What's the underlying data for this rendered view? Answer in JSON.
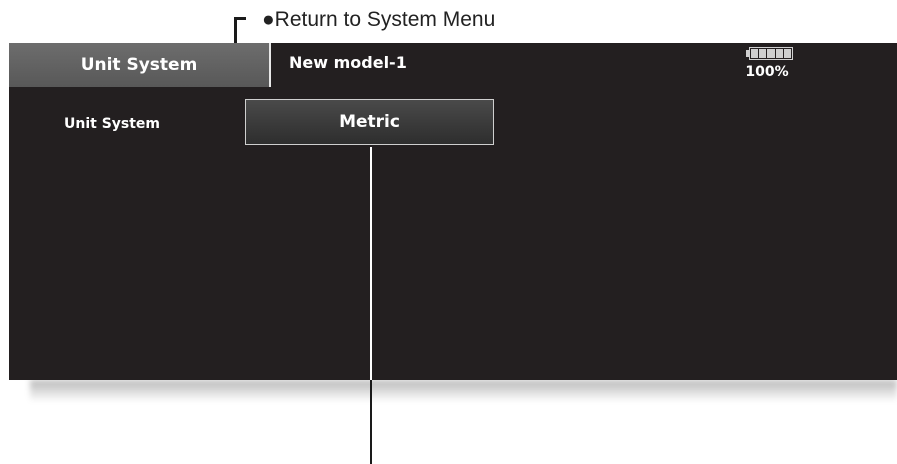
{
  "annotation": {
    "return_label": "●Return to System Menu"
  },
  "header": {
    "title": "Unit System",
    "model_name": "New model-1",
    "battery_percent": "100%",
    "battery_level": 1.0
  },
  "content": {
    "row_label": "Unit System",
    "unit_value": "Metric"
  },
  "colors": {
    "screen_bg": "#231f20",
    "tab_bg": "#6d6d6d",
    "text": "#ffffff"
  }
}
